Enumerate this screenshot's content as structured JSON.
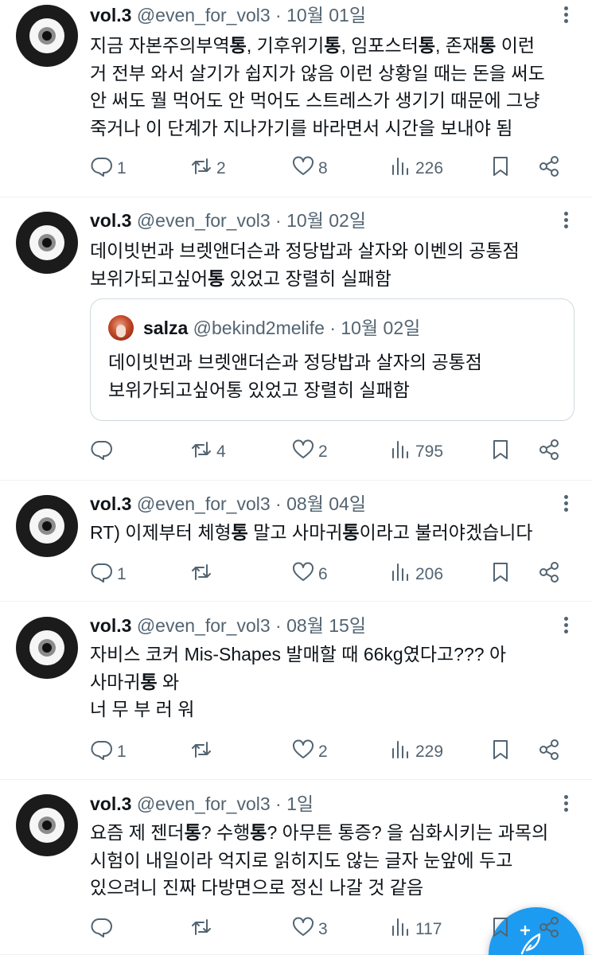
{
  "posts": [
    {
      "name": "vol.3",
      "handle": "@even_for_vol3",
      "dot": "·",
      "date": "10월 01일",
      "lines": [
        [
          {
            "t": "지금 자본주의부역",
            "b": false
          },
          {
            "t": "통",
            "b": true
          },
          {
            "t": ", 기후위기",
            "b": false
          },
          {
            "t": "통",
            "b": true
          },
          {
            "t": ", 임포스터",
            "b": false
          },
          {
            "t": "통",
            "b": true
          },
          {
            "t": ", 존재",
            "b": false
          },
          {
            "t": "통",
            "b": true
          },
          {
            "t": " 이런",
            "b": false
          }
        ],
        [
          {
            "t": "거 전부 와서 살기가 쉽지가 않음 이런 상황일 때는 돈을 써도",
            "b": false
          }
        ],
        [
          {
            "t": "안 써도 뭘 먹어도 안 먹어도 스트레스가 생기기 때문에 그냥",
            "b": false
          }
        ],
        [
          {
            "t": "죽거나 이 단계가 지나가기를 바라면서 시간을 보내야 됨",
            "b": false
          }
        ]
      ],
      "replies": "1",
      "retweets": "2",
      "likes": "8",
      "views": "226"
    },
    {
      "name": "vol.3",
      "handle": "@even_for_vol3",
      "dot": "·",
      "date": "10월 02일",
      "lines": [
        [
          {
            "t": "데이빗번과 브렛앤더슨과 정당밥과 살자와 이벤의 공통점",
            "b": false
          }
        ],
        [
          {
            "t": "보위가되고싶어",
            "b": false
          },
          {
            "t": "통",
            "b": true
          },
          {
            "t": " 있었고 장렬히 실패함",
            "b": false
          }
        ]
      ],
      "quote": {
        "name": "salza",
        "handle": "@bekind2melife",
        "dot": "·",
        "date": "10월 02일",
        "lines": [
          "데이빗번과 브렛앤더슨과 정당밥과 살자의 공통점",
          "보위가되고싶어통 있었고 장렬히 실패함"
        ]
      },
      "replies": "",
      "retweets": "4",
      "likes": "2",
      "views": "795"
    },
    {
      "name": "vol.3",
      "handle": "@even_for_vol3",
      "dot": "·",
      "date": "08월 04일",
      "lines": [
        [
          {
            "t": "RT) 이제부터 체형",
            "b": false
          },
          {
            "t": "통",
            "b": true
          },
          {
            "t": " 말고 사마귀",
            "b": false
          },
          {
            "t": "통",
            "b": true
          },
          {
            "t": "이라고 불러야겠습니다",
            "b": false
          }
        ]
      ],
      "replies": "1",
      "retweets": "",
      "likes": "6",
      "views": "206"
    },
    {
      "name": "vol.3",
      "handle": "@even_for_vol3",
      "dot": "·",
      "date": "08월 15일",
      "lines": [
        [
          {
            "t": "자비스 코커 Mis-Shapes 발매할 때 66kg였다고??? 아",
            "b": false
          }
        ],
        [
          {
            "t": "사마귀",
            "b": false
          },
          {
            "t": "통",
            "b": true
          },
          {
            "t": " 와",
            "b": false
          }
        ],
        [
          {
            "t": "너 무 부 러 워",
            "b": false
          }
        ]
      ],
      "replies": "1",
      "retweets": "",
      "likes": "2",
      "views": "229"
    },
    {
      "name": "vol.3",
      "handle": "@even_for_vol3",
      "dot": "·",
      "date": "1일",
      "lines": [
        [
          {
            "t": "요즘 제 젠더",
            "b": false
          },
          {
            "t": "통",
            "b": true
          },
          {
            "t": "? 수행",
            "b": false
          },
          {
            "t": "통",
            "b": true
          },
          {
            "t": "? 아무튼 통증? 을 심화시키는 과목의",
            "b": false
          }
        ],
        [
          {
            "t": "시험이 내일이라 억지로 읽히지도 않는 글자 눈앞에 두고",
            "b": false
          }
        ],
        [
          {
            "t": "있으려니 진짜 다방면으로 정신 나갈 것 같음",
            "b": false
          }
        ]
      ],
      "replies": "",
      "retweets": "",
      "likes": "3",
      "views": "117"
    }
  ],
  "icons": {
    "avatar": "eye-avatar",
    "reply": "reply-icon",
    "retweet": "retweet-icon",
    "like": "heart-icon",
    "views": "views-icon",
    "bookmark": "bookmark-icon",
    "share": "share-icon",
    "more": "more-icon",
    "compose": "compose-feather-icon"
  },
  "colors": {
    "text": "#0f1419",
    "secondary": "#536471",
    "divider": "#eff3f4",
    "accent": "#1d9bf0"
  }
}
